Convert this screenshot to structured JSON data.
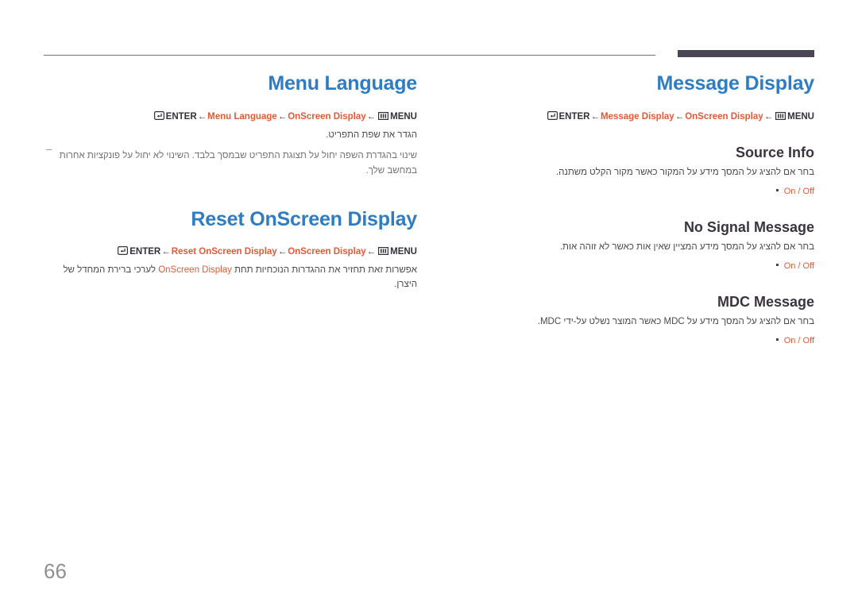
{
  "page": {
    "number": "66"
  },
  "icons": {
    "enter": "enter-key-icon",
    "menu": "menu-key-icon",
    "arrow": "←"
  },
  "left_column": {
    "sections": [
      {
        "title": "Menu Language",
        "breadcrumb": {
          "enter_label": "ENTER",
          "arrow": "←",
          "item1": "Menu Language",
          "item2": "OnScreen Display",
          "menu_label": "MENU"
        },
        "description": "הגדר את שפת התפריט.",
        "note": "שינוי בהגדרת השפה יחול על תצוגת התפריט שבמסך בלבד. השינוי לא יחול על פונקציות אחרות במחשב שלך."
      },
      {
        "title": "Reset OnScreen Display",
        "breadcrumb": {
          "enter_label": "ENTER",
          "arrow": "←",
          "item1": "Reset OnScreen Display",
          "item2": "OnScreen Display",
          "menu_label": "MENU"
        },
        "description_prefix": "אפשרות זאת תחזיר את ההגדרות הנוכחיות תחת ",
        "description_accent": "OnScreen Display",
        "description_suffix": " לערכי ברירת המחדל של היצרן."
      }
    ]
  },
  "right_column": {
    "title": "Message Display",
    "breadcrumb": {
      "enter_label": "ENTER",
      "arrow": "←",
      "item1": "Message Display",
      "item2": "OnScreen Display",
      "menu_label": "MENU"
    },
    "subsections": [
      {
        "title": "Source Info",
        "description": "בחר אם להציג על המסך מידע על המקור כאשר מקור הקלט משתנה.",
        "option": "On / Off"
      },
      {
        "title": "No Signal Message",
        "description": "בחר אם להציג על המסך מידע המציין שאין אות כאשר לא זוהה אות.",
        "option": "On / Off"
      },
      {
        "title": "MDC Message",
        "description": "בחר אם להציג על המסך מידע על MDC כאשר המוצר נשלט על-ידי MDC.",
        "option": "On / Off"
      }
    ]
  },
  "colors": {
    "heading_blue": "#2e7cc3",
    "accent_orange": "#e15a36",
    "subheading_dark": "#3a3340",
    "body_gray": "#4a4a50",
    "rule_dark": "#4b4556",
    "page_number_gray": "#8e9096"
  }
}
